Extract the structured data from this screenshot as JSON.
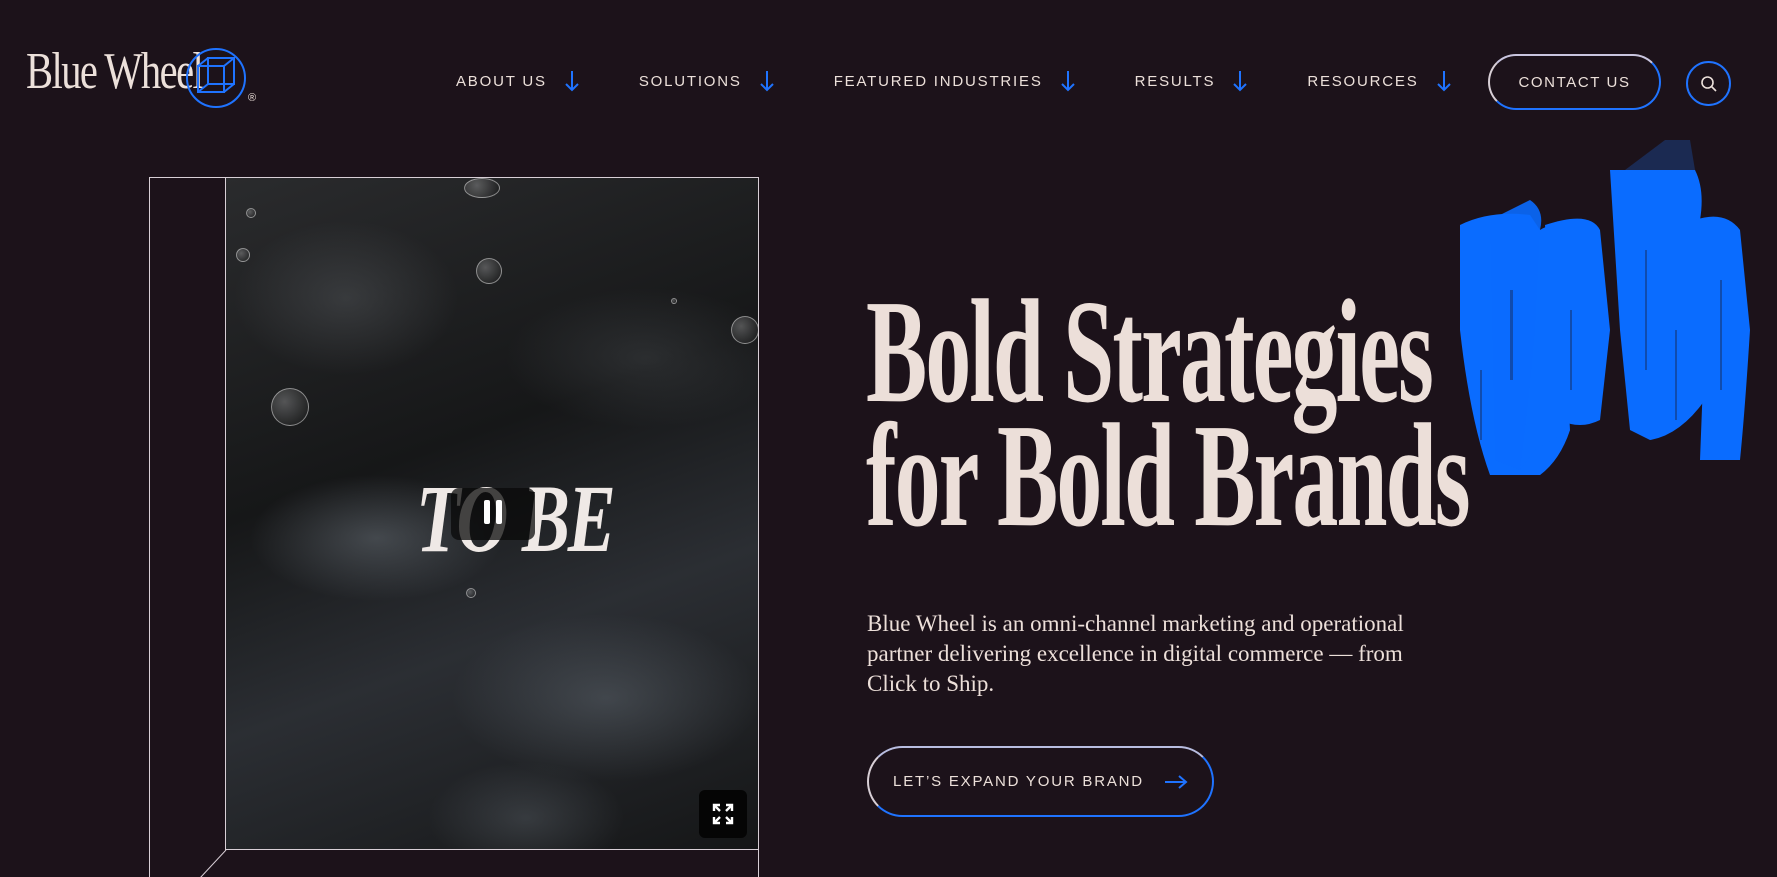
{
  "brand": {
    "name": "Blue Wheel",
    "mark_icon": "cube-circle-icon",
    "registered": "®"
  },
  "nav": {
    "items": [
      {
        "label": "ABOUT US",
        "icon": "arrow-down-icon"
      },
      {
        "label": "SOLUTIONS",
        "icon": "arrow-down-icon"
      },
      {
        "label": "FEATURED INDUSTRIES",
        "icon": "arrow-down-icon"
      },
      {
        "label": "RESULTS",
        "icon": "arrow-down-icon"
      },
      {
        "label": "RESOURCES",
        "icon": "arrow-down-icon"
      }
    ],
    "contact_label": "CONTACT US",
    "search_icon": "search-icon"
  },
  "video": {
    "caption": "TO BE",
    "pause_icon": "pause-icon",
    "fullscreen_icon": "fullscreen-icon"
  },
  "hero": {
    "title_line1": "Bold Strategies",
    "title_line2": "for Bold Brands",
    "description": "Blue Wheel is an omni-channel marketing and operational partner delivering excellence in digital commerce — from Click to Ship.",
    "cta_label": "LET’S EXPAND YOUR BRAND",
    "cta_icon": "arrow-right-icon"
  },
  "colors": {
    "background": "#1c121a",
    "accent": "#1f73ff",
    "text": "#ecdfd9"
  }
}
